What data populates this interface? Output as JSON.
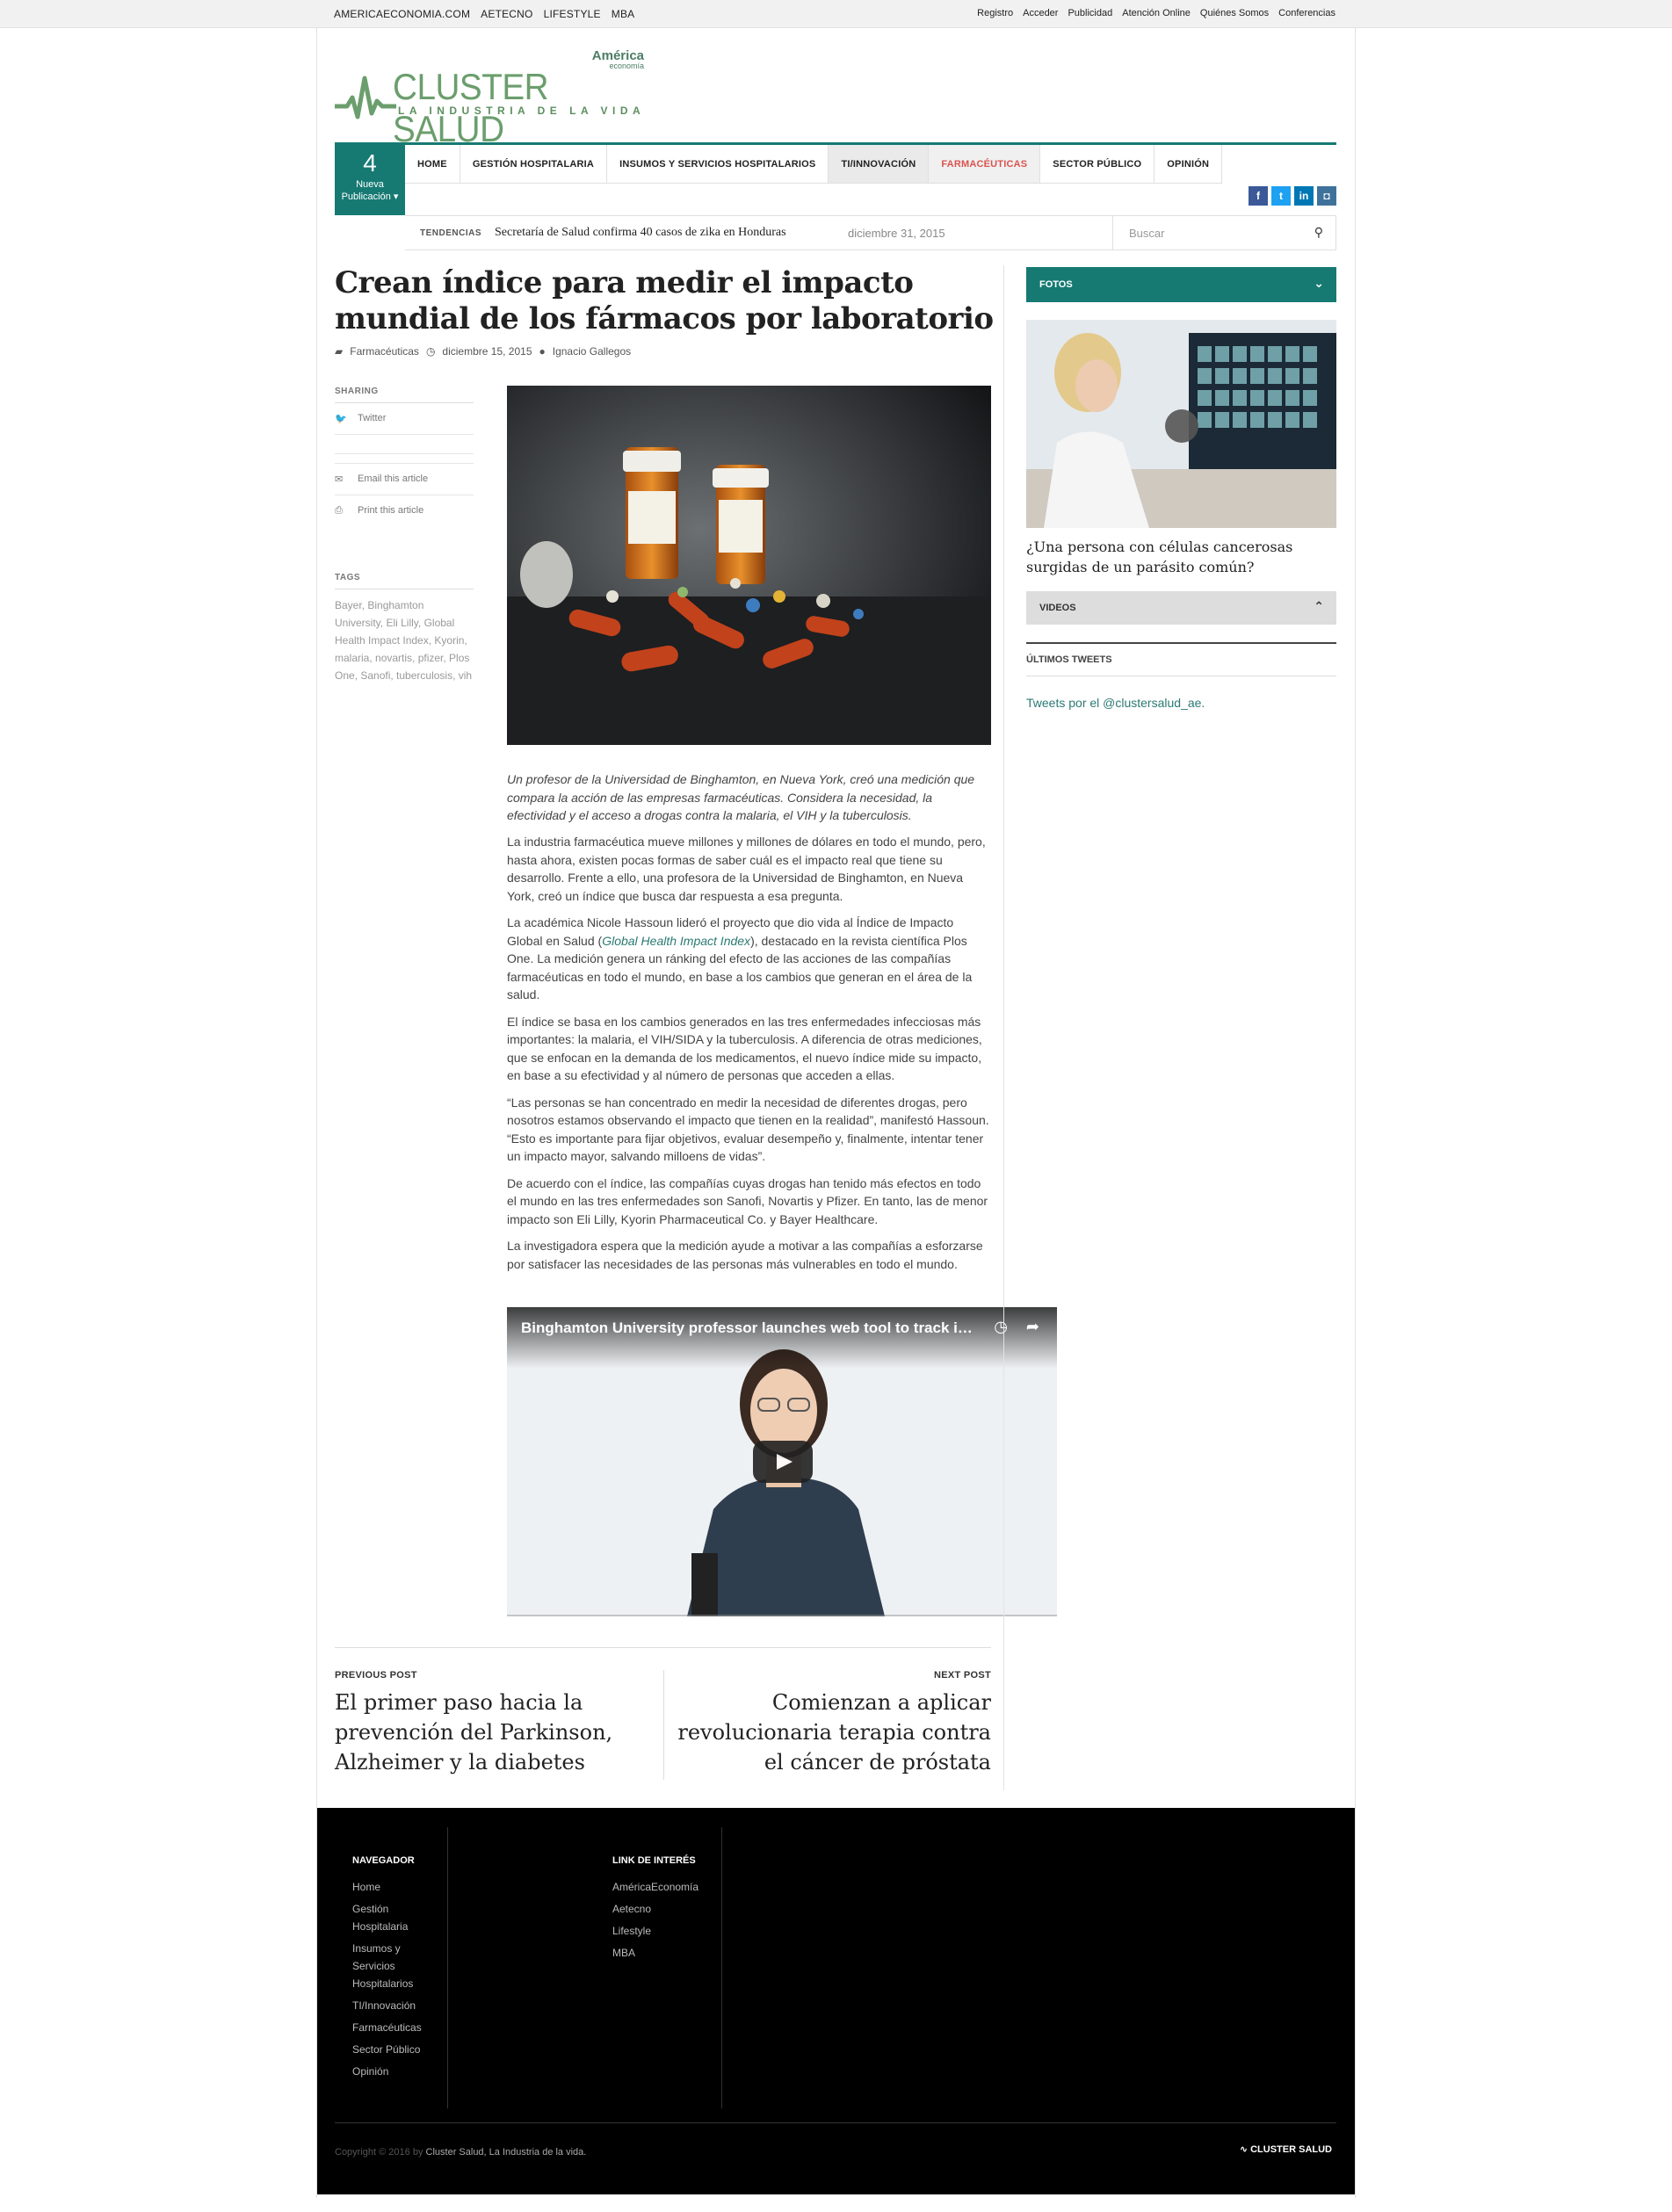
{
  "topbar": {
    "left": [
      "AMERICAECONOMIA.COM",
      "AETECNO",
      "LIFESTYLE",
      "MBA"
    ],
    "right": [
      "Registro",
      "Acceder",
      "Publicidad",
      "Atención Online",
      "Quiénes Somos",
      "Conferencias"
    ]
  },
  "logo": {
    "brand": "CLUSTER SALUD",
    "tagline": "LA INDUSTRIA DE LA VIDA",
    "america": "América",
    "economia": "economía"
  },
  "pub": {
    "number": "4",
    "label1": "Nueva",
    "label2": "Publicación ▾"
  },
  "nav": [
    "HOME",
    "GESTIÓN HOSPITALARIA",
    "INSUMOS Y SERVICIOS HOSPITALARIOS",
    "TI/INNOVACIÓN",
    "FARMACÉUTICAS",
    "SECTOR PÚBLICO",
    "OPINIÓN"
  ],
  "social": {
    "colors": {
      "facebook": "#3b5998",
      "twitter": "#1da1f2",
      "linkedin": "#0077b5",
      "instagram": "#3f729b"
    }
  },
  "trend": {
    "label": "TENDENCIAS",
    "title": "Secretaría de Salud confirma 40 casos de zika en Honduras",
    "date": "diciembre 31, 2015",
    "search_placeholder": "Buscar"
  },
  "article": {
    "title": "Crean índice para medir el impacto mundial de los fármacos por laboratorio",
    "category": "Farmacéuticas",
    "date": "diciembre 15, 2015",
    "author": "Ignacio Gallegos",
    "caption": "Un profesor de la Universidad de Binghamton, en Nueva York, creó una medición que compara la acción de las empresas farmacéuticas. Considera la necesidad, la efectividad y el acceso a drogas contra la malaria, el VIH y la tuberculosis.",
    "p1": "La industria farmacéutica mueve millones y millones de dólares en todo el mundo, pero, hasta ahora, existen pocas formas de saber cuál es el impacto real que tiene su desarrollo. Frente a ello, una profesora de la Universidad de Binghamton, en Nueva York, creó un índice que busca dar respuesta a esa pregunta.",
    "p2a": "La académica Nicole Hassoun lideró el proyecto que dio vida al Índice de Impacto Global en Salud (",
    "p2link": "Global Health Impact Index",
    "p2b": "), destacado en la revista científica Plos One. La medición genera un ránking del efecto de las acciones de las compañías farmacéuticas en todo el mundo, en base a los cambios que generan en el área de la salud.",
    "p3": "El índice se basa en los cambios generados en las tres enfermedades infecciosas más importantes: la malaria, el VIH/SIDA y la tuberculosis. A diferencia de otras mediciones, que se enfocan en la demanda de los medicamentos, el nuevo índice mide su impacto, en base a su efectividad y al número de personas que acceden a ellas.",
    "p4": "“Las personas se han concentrado en medir la necesidad de diferentes drogas, pero nosotros estamos observando el impacto que tienen en la realidad”, manifestó Hassoun. “Esto es importante para fijar objetivos, evaluar desempeño y, finalmente, intentar tener un impacto mayor, salvando milloens de vidas”.",
    "p5": "De acuerdo con el índice, las compañías cuyas drogas han tenido más efectos en todo el mundo en las tres enfermedades son Sanofi, Novartis y Pfizer. En tanto, las de menor impacto son Eli Lilly, Kyorin Pharmaceutical Co. y Bayer Healthcare.",
    "p6": "La investigadora espera que la medición ayude a motivar a las compañías a esforzarse por satisfacer las necesidades de las personas más vulnerables en todo el mundo.",
    "video_title": "Binghamton University professor launches web tool to track imp..."
  },
  "sharing": {
    "heading": "SHARING",
    "twitter": "Twitter",
    "email": "Email this article",
    "print": "Print this article"
  },
  "tags": {
    "heading": "TAGS",
    "list": "Bayer, Binghamton University, Eli Lilly, Global Health Impact Index, Kyorin, malaria, novartis, pfizer, Plos One, Sanofi, tuberculosis, vih"
  },
  "prevnext": {
    "prev_label": "PREVIOUS POST",
    "prev_title": "El primer paso hacia la prevención del Parkinson, Alzheimer y la diabetes",
    "next_label": "NEXT POST",
    "next_title": "Comienzan a aplicar revolucionaria terapia contra el cáncer de próstata"
  },
  "sidebar": {
    "fotos": "FOTOS",
    "photo_caption": "¿Una persona con células cancerosas surgidas de un parásito común?",
    "videos": "VIDEOS",
    "tweets_heading": "ÚLTIMOS TWEETS",
    "tweets_link": "Tweets por el @clustersalud_ae."
  },
  "footer": {
    "nav_heading": "NAVEGADOR",
    "nav": [
      "Home",
      "Gestión Hospitalaria",
      "Insumos y Servicios Hospitalarios",
      "TI/Innovación",
      "Farmacéuticas",
      "Sector Público",
      "Opinión"
    ],
    "links_heading": "LINK DE INTERÉS",
    "links": [
      "AméricaEconomía",
      "Aetecno",
      "Lifestyle",
      "MBA"
    ],
    "copy_prefix": "Copyright © 2016 by",
    "copy_name": "Cluster Salud, La Industria de la vida.",
    "logo_text": "CLUSTER SALUD"
  }
}
